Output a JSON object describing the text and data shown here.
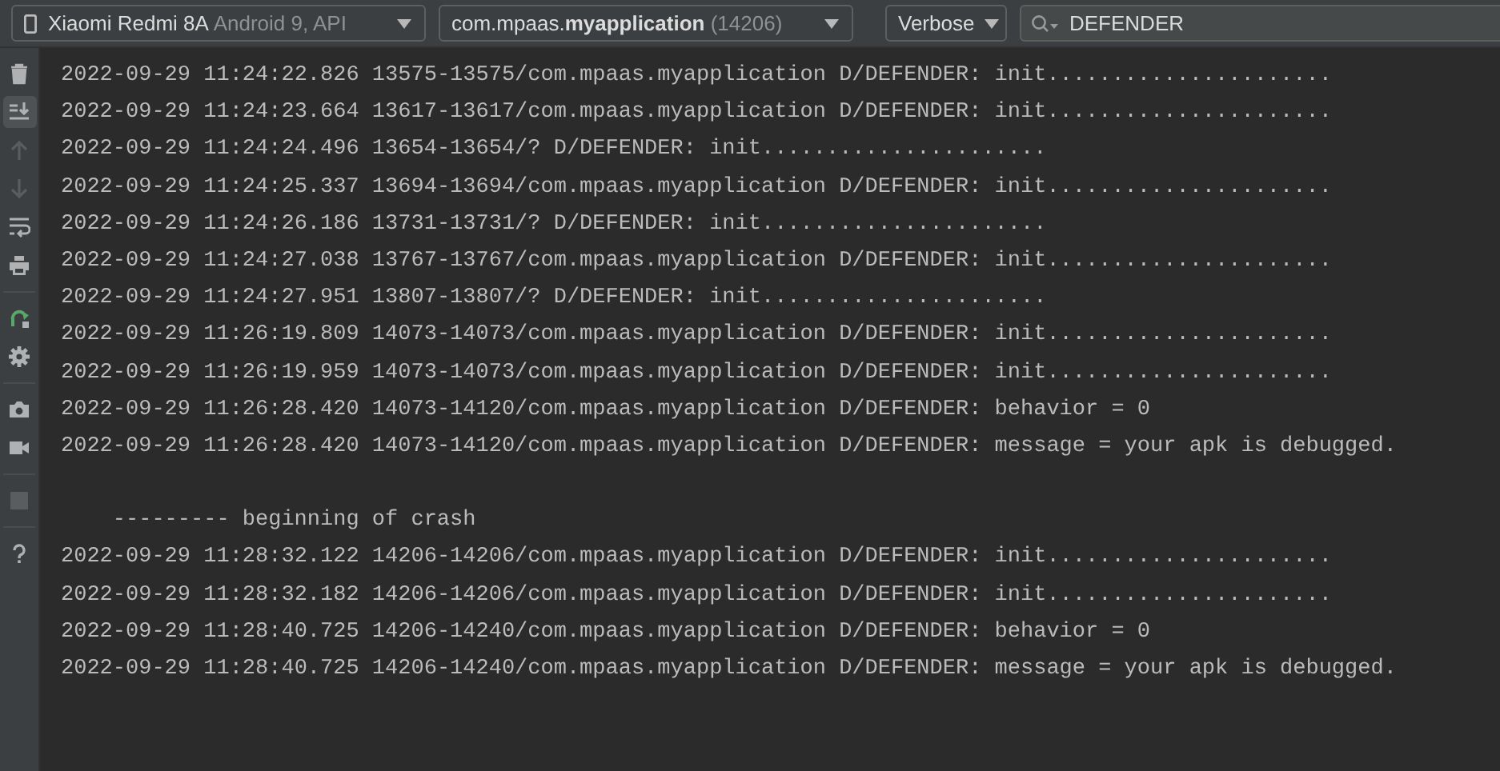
{
  "toolbar": {
    "device": {
      "name": "Xiaomi Redmi 8A",
      "detail": "Android 9, API"
    },
    "process": {
      "label": "com.mpaas.**myapplication**",
      "pid": "(14206)"
    },
    "log_level": "Verbose",
    "search": {
      "value": "DEFENDER"
    }
  },
  "side_tools": [
    {
      "kind": "trash",
      "selected": false,
      "disabled": false
    },
    {
      "kind": "scroll-end",
      "selected": true,
      "disabled": false
    },
    {
      "kind": "up",
      "selected": false,
      "disabled": true
    },
    {
      "kind": "down",
      "selected": false,
      "disabled": true
    },
    {
      "kind": "wrap",
      "selected": false,
      "disabled": false
    },
    {
      "kind": "print",
      "selected": false,
      "disabled": false
    },
    {
      "kind": "restart",
      "selected": false,
      "disabled": false
    },
    {
      "kind": "settings",
      "selected": false,
      "disabled": false
    },
    {
      "kind": "camera",
      "selected": false,
      "disabled": false
    },
    {
      "kind": "video",
      "selected": false,
      "disabled": false
    },
    {
      "kind": "stop",
      "selected": false,
      "disabled": true
    },
    {
      "kind": "help",
      "selected": false,
      "disabled": false
    }
  ],
  "log_lines": [
    "2022-09-29 11:24:22.826 13575-13575/com.mpaas.myapplication D/DEFENDER: init......................",
    "2022-09-29 11:24:23.664 13617-13617/com.mpaas.myapplication D/DEFENDER: init......................",
    "2022-09-29 11:24:24.496 13654-13654/? D/DEFENDER: init......................",
    "2022-09-29 11:24:25.337 13694-13694/com.mpaas.myapplication D/DEFENDER: init......................",
    "2022-09-29 11:24:26.186 13731-13731/? D/DEFENDER: init......................",
    "2022-09-29 11:24:27.038 13767-13767/com.mpaas.myapplication D/DEFENDER: init......................",
    "2022-09-29 11:24:27.951 13807-13807/? D/DEFENDER: init......................",
    "2022-09-29 11:26:19.809 14073-14073/com.mpaas.myapplication D/DEFENDER: init......................",
    "2022-09-29 11:26:19.959 14073-14073/com.mpaas.myapplication D/DEFENDER: init......................",
    "2022-09-29 11:26:28.420 14073-14120/com.mpaas.myapplication D/DEFENDER: behavior = 0",
    "2022-09-29 11:26:28.420 14073-14120/com.mpaas.myapplication D/DEFENDER: message = your apk is debugged."
  ],
  "crash_section": {
    "header": "--------- beginning of crash",
    "lines": [
      "2022-09-29 11:28:32.122 14206-14206/com.mpaas.myapplication D/DEFENDER: init......................",
      "2022-09-29 11:28:32.182 14206-14206/com.mpaas.myapplication D/DEFENDER: init......................",
      "2022-09-29 11:28:40.725 14206-14240/com.mpaas.myapplication D/DEFENDER: behavior = 0",
      "2022-09-29 11:28:40.725 14206-14240/com.mpaas.myapplication D/DEFENDER: message = your apk is debugged."
    ]
  }
}
